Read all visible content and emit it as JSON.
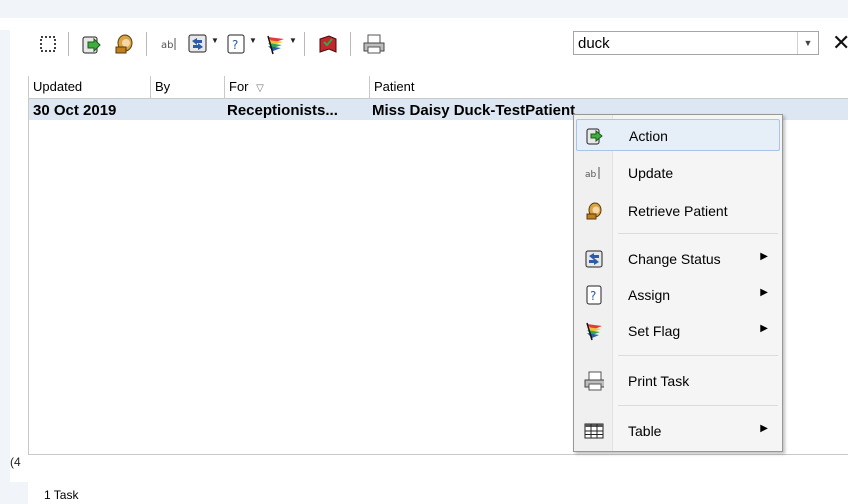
{
  "toolbar": {
    "search_value": "duck",
    "close_glyph": "✕"
  },
  "columns": [
    "Updated",
    "By",
    "For",
    "Patient"
  ],
  "row": {
    "updated": "30 Oct 2019",
    "by": "",
    "for": "Receptionists...",
    "patient": "Miss Daisy Duck-TestPatient"
  },
  "status": "1 Task",
  "left_fragment": "(4",
  "context_menu": {
    "items": [
      {
        "label": "Action",
        "icon": "action-arrow-icon"
      },
      {
        "label": "Update",
        "icon": "text-edit-icon"
      },
      {
        "label": "Retrieve Patient",
        "icon": "retrieve-patient-icon"
      },
      {
        "label": "Change Status",
        "icon": "change-status-icon"
      },
      {
        "label": "Assign",
        "icon": "assign-icon"
      },
      {
        "label": "Set Flag",
        "icon": "flag-icon"
      },
      {
        "label": "Print Task",
        "icon": "printer-icon"
      },
      {
        "label": "Table",
        "icon": "table-icon"
      }
    ],
    "submenu_glyph": "▶"
  },
  "colors": {
    "selection": "#dde7f3",
    "highlight": "#e6eef8",
    "accent_green": "#2f8a2f",
    "accent_blue": "#2a5caa"
  }
}
